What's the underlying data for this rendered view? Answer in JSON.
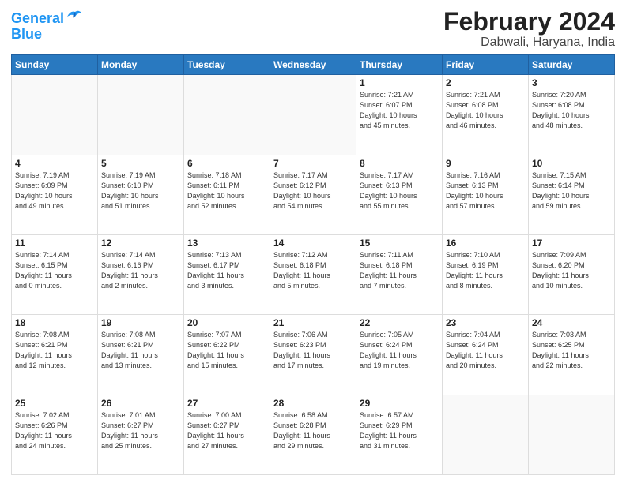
{
  "logo": {
    "line1": "General",
    "line2": "Blue"
  },
  "title": "February 2024",
  "subtitle": "Dabwali, Haryana, India",
  "weekdays": [
    "Sunday",
    "Monday",
    "Tuesday",
    "Wednesday",
    "Thursday",
    "Friday",
    "Saturday"
  ],
  "weeks": [
    [
      {
        "day": "",
        "info": ""
      },
      {
        "day": "",
        "info": ""
      },
      {
        "day": "",
        "info": ""
      },
      {
        "day": "",
        "info": ""
      },
      {
        "day": "1",
        "info": "Sunrise: 7:21 AM\nSunset: 6:07 PM\nDaylight: 10 hours\nand 45 minutes."
      },
      {
        "day": "2",
        "info": "Sunrise: 7:21 AM\nSunset: 6:08 PM\nDaylight: 10 hours\nand 46 minutes."
      },
      {
        "day": "3",
        "info": "Sunrise: 7:20 AM\nSunset: 6:08 PM\nDaylight: 10 hours\nand 48 minutes."
      }
    ],
    [
      {
        "day": "4",
        "info": "Sunrise: 7:19 AM\nSunset: 6:09 PM\nDaylight: 10 hours\nand 49 minutes."
      },
      {
        "day": "5",
        "info": "Sunrise: 7:19 AM\nSunset: 6:10 PM\nDaylight: 10 hours\nand 51 minutes."
      },
      {
        "day": "6",
        "info": "Sunrise: 7:18 AM\nSunset: 6:11 PM\nDaylight: 10 hours\nand 52 minutes."
      },
      {
        "day": "7",
        "info": "Sunrise: 7:17 AM\nSunset: 6:12 PM\nDaylight: 10 hours\nand 54 minutes."
      },
      {
        "day": "8",
        "info": "Sunrise: 7:17 AM\nSunset: 6:13 PM\nDaylight: 10 hours\nand 55 minutes."
      },
      {
        "day": "9",
        "info": "Sunrise: 7:16 AM\nSunset: 6:13 PM\nDaylight: 10 hours\nand 57 minutes."
      },
      {
        "day": "10",
        "info": "Sunrise: 7:15 AM\nSunset: 6:14 PM\nDaylight: 10 hours\nand 59 minutes."
      }
    ],
    [
      {
        "day": "11",
        "info": "Sunrise: 7:14 AM\nSunset: 6:15 PM\nDaylight: 11 hours\nand 0 minutes."
      },
      {
        "day": "12",
        "info": "Sunrise: 7:14 AM\nSunset: 6:16 PM\nDaylight: 11 hours\nand 2 minutes."
      },
      {
        "day": "13",
        "info": "Sunrise: 7:13 AM\nSunset: 6:17 PM\nDaylight: 11 hours\nand 3 minutes."
      },
      {
        "day": "14",
        "info": "Sunrise: 7:12 AM\nSunset: 6:18 PM\nDaylight: 11 hours\nand 5 minutes."
      },
      {
        "day": "15",
        "info": "Sunrise: 7:11 AM\nSunset: 6:18 PM\nDaylight: 11 hours\nand 7 minutes."
      },
      {
        "day": "16",
        "info": "Sunrise: 7:10 AM\nSunset: 6:19 PM\nDaylight: 11 hours\nand 8 minutes."
      },
      {
        "day": "17",
        "info": "Sunrise: 7:09 AM\nSunset: 6:20 PM\nDaylight: 11 hours\nand 10 minutes."
      }
    ],
    [
      {
        "day": "18",
        "info": "Sunrise: 7:08 AM\nSunset: 6:21 PM\nDaylight: 11 hours\nand 12 minutes."
      },
      {
        "day": "19",
        "info": "Sunrise: 7:08 AM\nSunset: 6:21 PM\nDaylight: 11 hours\nand 13 minutes."
      },
      {
        "day": "20",
        "info": "Sunrise: 7:07 AM\nSunset: 6:22 PM\nDaylight: 11 hours\nand 15 minutes."
      },
      {
        "day": "21",
        "info": "Sunrise: 7:06 AM\nSunset: 6:23 PM\nDaylight: 11 hours\nand 17 minutes."
      },
      {
        "day": "22",
        "info": "Sunrise: 7:05 AM\nSunset: 6:24 PM\nDaylight: 11 hours\nand 19 minutes."
      },
      {
        "day": "23",
        "info": "Sunrise: 7:04 AM\nSunset: 6:24 PM\nDaylight: 11 hours\nand 20 minutes."
      },
      {
        "day": "24",
        "info": "Sunrise: 7:03 AM\nSunset: 6:25 PM\nDaylight: 11 hours\nand 22 minutes."
      }
    ],
    [
      {
        "day": "25",
        "info": "Sunrise: 7:02 AM\nSunset: 6:26 PM\nDaylight: 11 hours\nand 24 minutes."
      },
      {
        "day": "26",
        "info": "Sunrise: 7:01 AM\nSunset: 6:27 PM\nDaylight: 11 hours\nand 25 minutes."
      },
      {
        "day": "27",
        "info": "Sunrise: 7:00 AM\nSunset: 6:27 PM\nDaylight: 11 hours\nand 27 minutes."
      },
      {
        "day": "28",
        "info": "Sunrise: 6:58 AM\nSunset: 6:28 PM\nDaylight: 11 hours\nand 29 minutes."
      },
      {
        "day": "29",
        "info": "Sunrise: 6:57 AM\nSunset: 6:29 PM\nDaylight: 11 hours\nand 31 minutes."
      },
      {
        "day": "",
        "info": ""
      },
      {
        "day": "",
        "info": ""
      }
    ]
  ]
}
